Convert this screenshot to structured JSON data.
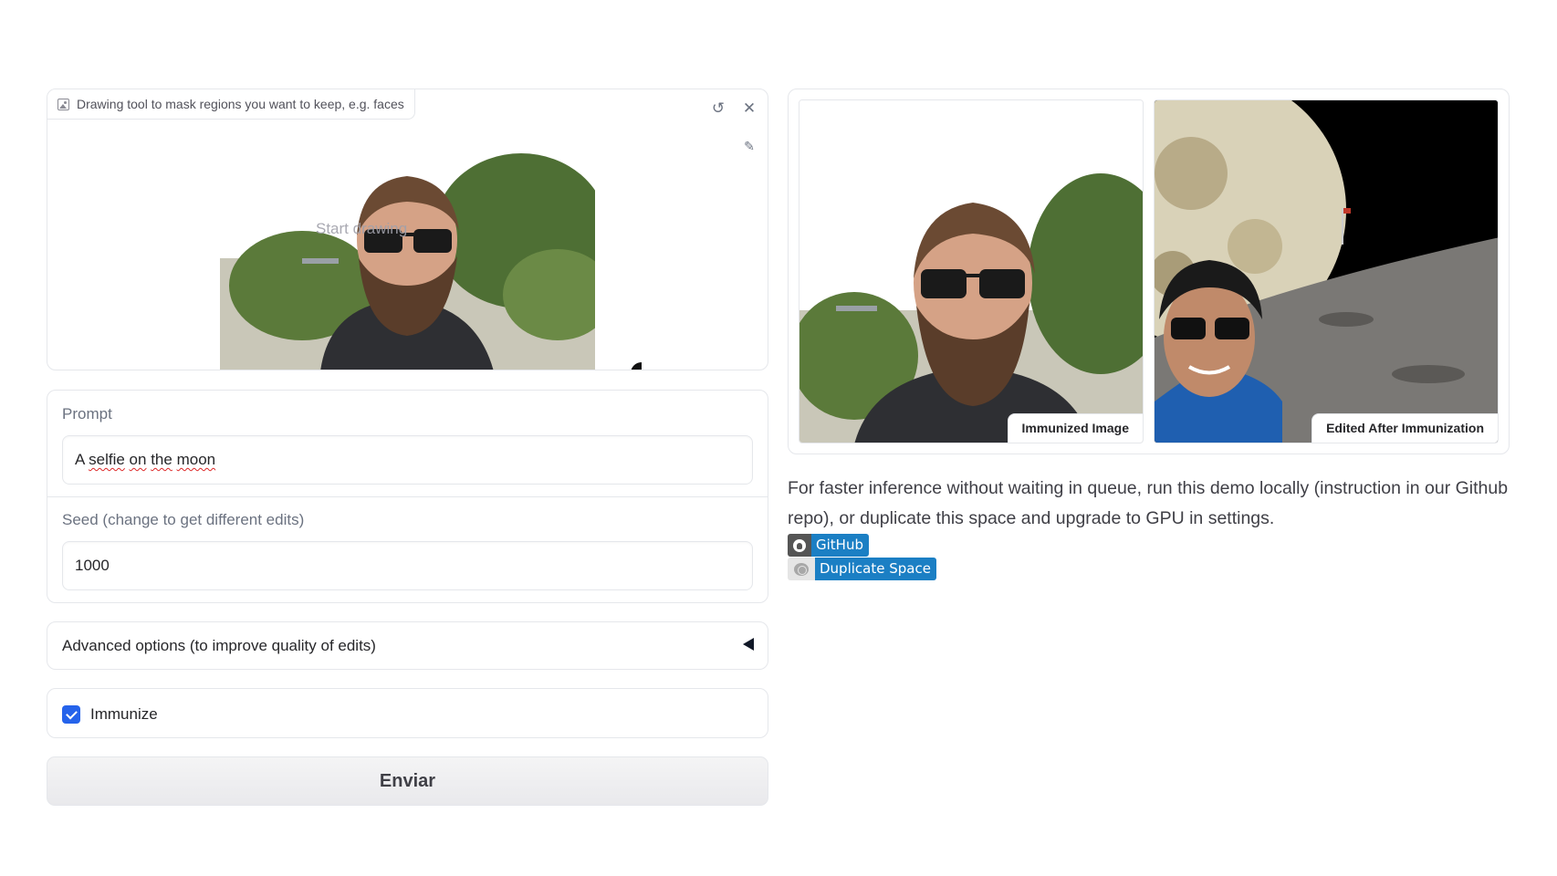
{
  "sketch": {
    "label": "Drawing tool to mask regions you want to keep, e.g. faces",
    "placeholder_text": "Start drawing",
    "icons": [
      "image-icon",
      "undo-icon",
      "close-icon",
      "brush-icon"
    ]
  },
  "prompt": {
    "label": "Prompt",
    "value_prefix": "A ",
    "value_words": [
      "selfie",
      "on",
      "the",
      "moon"
    ]
  },
  "seed": {
    "label": "Seed (change to get different edits)",
    "value": "1000"
  },
  "advanced": {
    "label": "Advanced options (to improve quality of edits)",
    "state": "collapsed"
  },
  "immunize": {
    "label": "Immunize",
    "checked": true
  },
  "submit": {
    "label": "Enviar"
  },
  "gallery": {
    "items": [
      {
        "caption": "Immunized Image"
      },
      {
        "caption": "Edited After Immunization"
      }
    ]
  },
  "description": "For faster inference without waiting in queue, run this demo locally (instruction in our Github repo), or duplicate this space and upgrade to GPU in settings.",
  "badges": {
    "github": {
      "label": "GitHub",
      "icon": "github-icon"
    },
    "duplicate": {
      "label": "Duplicate Space",
      "icon": "huggingface-icon"
    }
  },
  "colors": {
    "accent_checkbox": "#2563eb",
    "badge_blue": "#1b7fc4",
    "border": "#e5e7eb"
  }
}
